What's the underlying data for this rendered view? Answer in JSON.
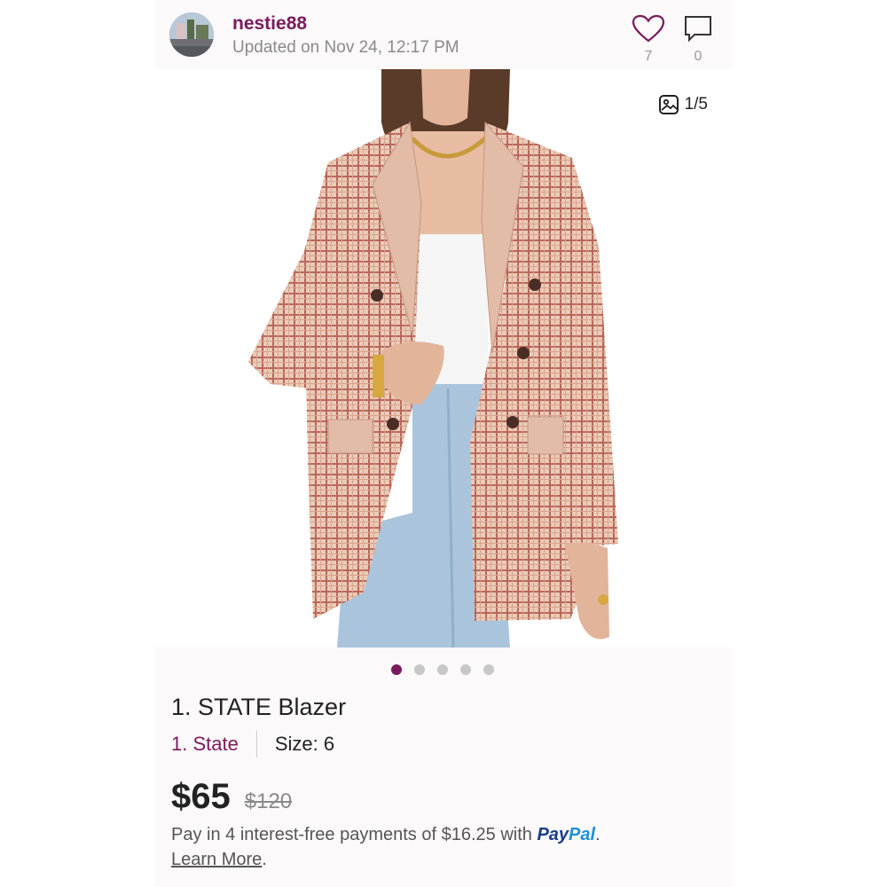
{
  "header": {
    "username": "nestie88",
    "updated": "Updated on Nov 24, 12:17 PM",
    "likes": "7",
    "comments": "0"
  },
  "gallery": {
    "counter": "1/5",
    "dots": 5,
    "active_dot": 1
  },
  "listing": {
    "title": "1. STATE Blazer",
    "brand": "1. State",
    "size": "Size: 6",
    "price": "$65",
    "original_price": "$120",
    "paypal_text": "Pay in 4 interest-free payments of $16.25 with",
    "paypal_brand_pay": "Pay",
    "paypal_brand_pal": "Pal",
    "learn_more": "Learn More"
  },
  "colors": {
    "accent": "#7a1a5c",
    "muted": "#8a8a8a"
  }
}
